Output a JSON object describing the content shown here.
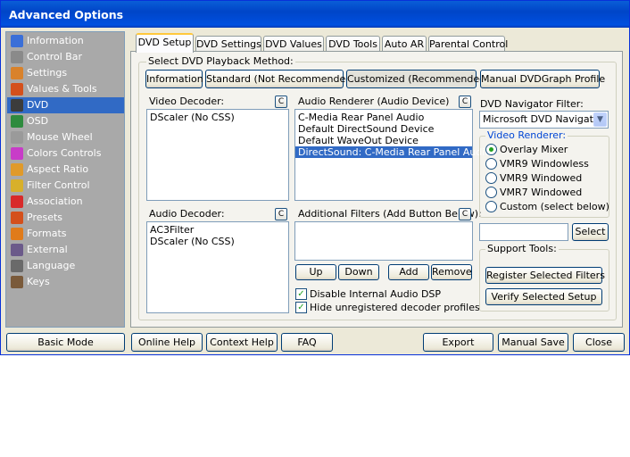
{
  "window": {
    "title": "Advanced Options"
  },
  "sidebar": {
    "items": [
      {
        "label": "Information",
        "icon": "info-icon",
        "color": "#3a6fd8"
      },
      {
        "label": "Control Bar",
        "icon": "control-bar-icon",
        "color": "#8a8a8a"
      },
      {
        "label": "Settings",
        "icon": "settings-icon",
        "color": "#d9822b"
      },
      {
        "label": "Values & Tools",
        "icon": "values-tools-icon",
        "color": "#d4501c"
      },
      {
        "label": "DVD",
        "icon": "dvd-icon",
        "color": "#3c3c3c",
        "selected": true
      },
      {
        "label": "OSD",
        "icon": "osd-icon",
        "color": "#2e8b3e"
      },
      {
        "label": "Mouse Wheel",
        "icon": "mouse-wheel-icon",
        "color": "#9a9a9a"
      },
      {
        "label": "Colors Controls",
        "icon": "colors-icon",
        "color": "#c83cc8"
      },
      {
        "label": "Aspect Ratio",
        "icon": "aspect-ratio-icon",
        "color": "#e09a2a"
      },
      {
        "label": "Filter Control",
        "icon": "filter-control-icon",
        "color": "#d8b02a"
      },
      {
        "label": "Association",
        "icon": "association-icon",
        "color": "#d82a2a"
      },
      {
        "label": "Presets",
        "icon": "presets-icon",
        "color": "#d4501c"
      },
      {
        "label": "Formats",
        "icon": "formats-icon",
        "color": "#e07b1a"
      },
      {
        "label": "External",
        "icon": "external-icon",
        "color": "#6b5a8a"
      },
      {
        "label": "Language",
        "icon": "language-icon",
        "color": "#6a6a6a"
      },
      {
        "label": "Keys",
        "icon": "keys-icon",
        "color": "#7a5a3a"
      }
    ]
  },
  "tabs": [
    "DVD Setup",
    "DVD Settings",
    "DVD Values",
    "DVD Tools",
    "Auto AR",
    "Parental Control"
  ],
  "playback": {
    "legend": "Select DVD Playback Method:",
    "methods": [
      "Information",
      "Standard (Not Recommended)",
      "Customized (Recommended)",
      "Manual DVDGraph Profile"
    ]
  },
  "video_decoder": {
    "label": "Video Decoder:",
    "c_label": "C",
    "items": [
      "DScaler (No CSS)"
    ]
  },
  "audio_renderer": {
    "label": "Audio Renderer (Audio Device)",
    "c_label": "C",
    "items": [
      "C-Media Rear Panel Audio",
      "Default DirectSound Device",
      "Default WaveOut Device",
      "DirectSound: C-Media Rear Panel Audio"
    ],
    "selected_index": 3
  },
  "audio_decoder": {
    "label": "Audio Decoder:",
    "c_label": "C",
    "items": [
      "AC3Filter",
      "DScaler (No CSS)"
    ]
  },
  "additional_filters": {
    "label": "Additional Filters (Add Button Below):",
    "c_label": "C",
    "items": [],
    "buttons": {
      "up": "Up",
      "down": "Down",
      "add": "Add",
      "remove": "Remove"
    }
  },
  "checkboxes": {
    "disable_dsp": {
      "label": "Disable Internal Audio DSP",
      "checked": true
    },
    "hide_unregistered": {
      "label": "Hide unregistered decoder profiles",
      "checked": true
    }
  },
  "navigator": {
    "label": "DVD Navigator Filter:",
    "value": "Microsoft DVD Navigator"
  },
  "video_renderer": {
    "legend": "Video Renderer:",
    "options": [
      "Overlay Mixer",
      "VMR9 Windowless",
      "VMR9 Windowed",
      "VMR7 Windowed",
      "Custom (select below)"
    ],
    "selected_index": 0
  },
  "custom_select": {
    "value": "",
    "button": "Select"
  },
  "support": {
    "legend": "Support Tools:",
    "register": "Register Selected Filters",
    "verify": "Verify Selected Setup"
  },
  "bottom": {
    "basic_mode": "Basic Mode",
    "online_help": "Online Help",
    "context_help": "Context Help",
    "faq": "FAQ",
    "export": "Export",
    "manual_save": "Manual Save",
    "close": "Close"
  }
}
